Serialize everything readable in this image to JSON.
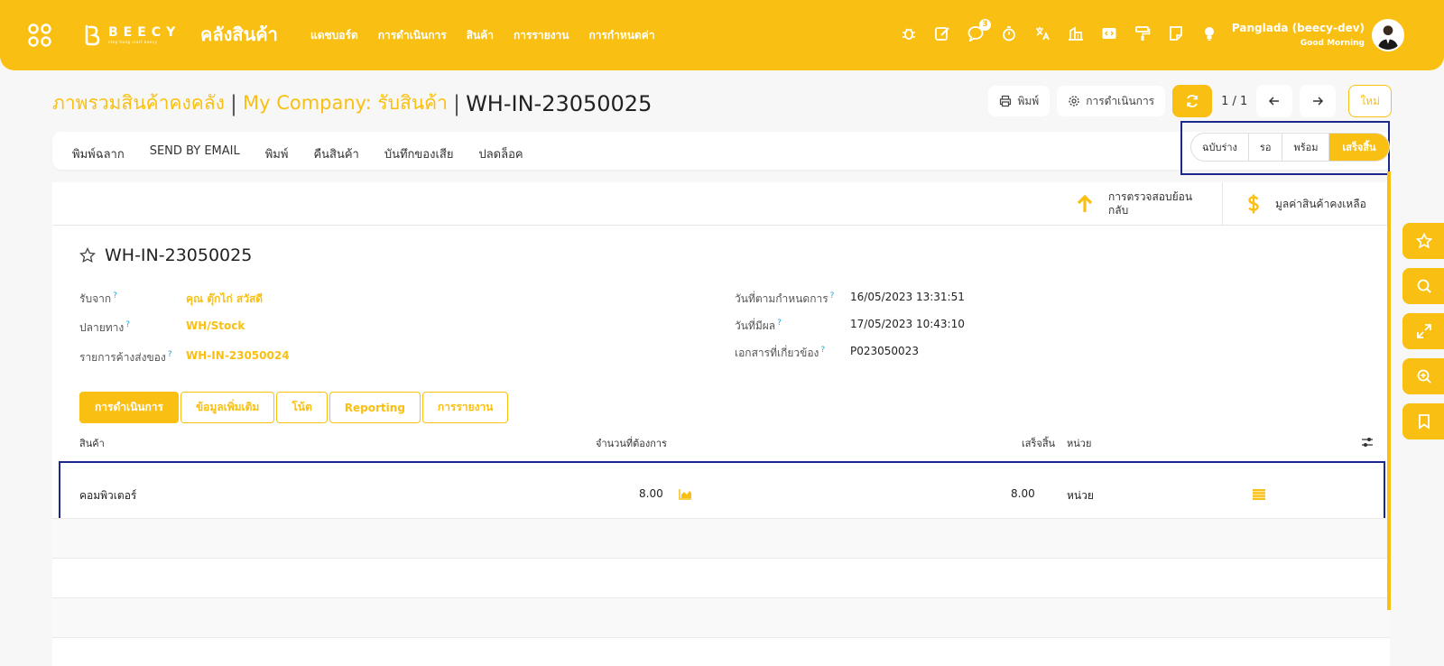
{
  "topbar": {
    "logo_word": "BEECY",
    "logo_tagline": "step hung start beecy",
    "app_title": "คลังสินค้า",
    "menu": [
      "แดชบอร์ด",
      "การดำเนินการ",
      "สินค้า",
      "การรายงาน",
      "การกำหนดค่า"
    ],
    "icons": [
      "bug-icon",
      "edit-icon",
      "chat-icon",
      "timer-icon",
      "translate-icon",
      "building-icon",
      "code-icon",
      "paint-roller-icon",
      "note-icon",
      "lightbulb-icon"
    ],
    "chat_badge": "3",
    "user_name": "Panglada (beecy-dev)",
    "greeting": "Good Morning"
  },
  "breadcrumb": {
    "items": [
      "ภาพรวมสินค้าคงคลัง",
      "My Company: รับสินค้า"
    ],
    "current": "WH-IN-23050025"
  },
  "control": {
    "print_label": "พิมพ์",
    "action_label": "การดำเนินการ",
    "pager": "1 / 1",
    "new_label": "ใหม่"
  },
  "toolbar": {
    "buttons": [
      "พิมพ์ฉลาก",
      "SEND BY EMAIL",
      "พิมพ์",
      "คืนสินค้า",
      "บันทึกของเสีย",
      "ปลดล็อค"
    ]
  },
  "statusbar": {
    "stages": [
      "ฉบับร่าง",
      "รอ",
      "พร้อม",
      "เสร็จสิ้น"
    ],
    "active": "เสร็จสิ้น"
  },
  "smart_buttons": {
    "traceability": "การตรวจสอบย้อนกลับ",
    "valuation": "มูลค่าสินค้าคงเหลือ"
  },
  "record": {
    "name": "WH-IN-23050025",
    "left_fields": [
      {
        "label": "รับจาก",
        "value": "คุณ ตุ๊กไก่ สวัสดี"
      },
      {
        "label": "ปลายทาง",
        "value": "WH/Stock"
      },
      {
        "label": "รายการค้างส่งของ",
        "value": "WH-IN-23050024"
      }
    ],
    "right_fields": [
      {
        "label": "วันที่ตามกำหนดการ",
        "value": "16/05/2023 13:31:51"
      },
      {
        "label": "วันที่มีผล",
        "value": "17/05/2023 10:43:10"
      },
      {
        "label": "เอกสารที่เกี่ยวข้อง",
        "value": "P023050023"
      }
    ]
  },
  "tabs": [
    "การดำเนินการ",
    "ข้อมูลเพิ่มเติม",
    "โน้ต",
    "Reporting",
    "การรายงาน"
  ],
  "lines": {
    "headers": [
      "สินค้า",
      "จำนวนที่ต้องการ",
      "เสร็จสิ้น",
      "หน่วย"
    ],
    "rows": [
      {
        "product": "คอมพิวเตอร์",
        "demand": "8.00",
        "done": "8.00",
        "uom": "หน่วย"
      }
    ]
  },
  "colors": {
    "brand": "#f9c013",
    "highlight": "#1b2a8a"
  }
}
